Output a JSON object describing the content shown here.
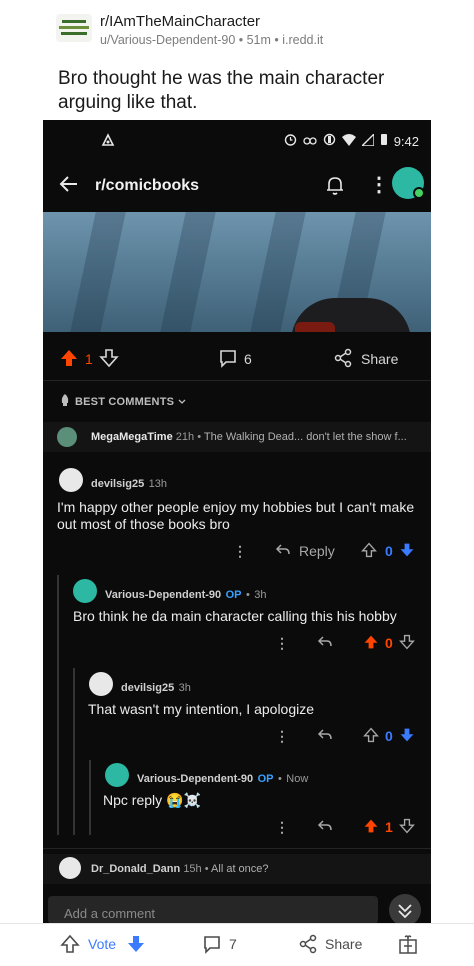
{
  "post": {
    "subreddit": "r/IAmTheMainCharacter",
    "meta": "u/Various-Dependent-90 • 51m • i.redd.it",
    "title": "Bro thought he was the main character arguing like that."
  },
  "screenshot": {
    "status_time": "9:42",
    "appbar_title": "r/comicbooks",
    "vote_count": "1",
    "comment_count": "6",
    "share_label": "Share",
    "best_comments_label": "BEST COMMENTS",
    "collapsed_comment": {
      "author": "MegaMegaTime",
      "time": "21h",
      "preview": "The Walking Dead... don't let the show f..."
    },
    "comments": [
      {
        "author": "devilsig25",
        "time": "13h",
        "text": "I'm happy other people enjoy my hobbies but I can't make out most of those books bro",
        "reply_label": "Reply",
        "score": "0"
      },
      {
        "author": "Various-Dependent-90",
        "op": "OP",
        "time": "3h",
        "text": "Bro think he da main character calling this his hobby",
        "score": "0"
      },
      {
        "author": "devilsig25",
        "time": "3h",
        "text": "That wasn't my intention, I apologize",
        "score": "0"
      },
      {
        "author": "Various-Dependent-90",
        "op": "OP",
        "time": "Now",
        "text": "Npc reply 😭☠️",
        "score": "1"
      }
    ],
    "last_comment": {
      "author": "Dr_Donald_Dann",
      "time": "15h",
      "preview": "All at once?"
    },
    "add_comment_placeholder": "Add a comment"
  },
  "bottom_bar": {
    "vote_label": "Vote",
    "comments": "7",
    "share_label": "Share"
  },
  "colors": {
    "upvote_orange": "#ff4500",
    "downvote_blue": "#3a7bff",
    "op_blue": "#3aa0ff",
    "teal_avatar": "#2cb8a2"
  }
}
